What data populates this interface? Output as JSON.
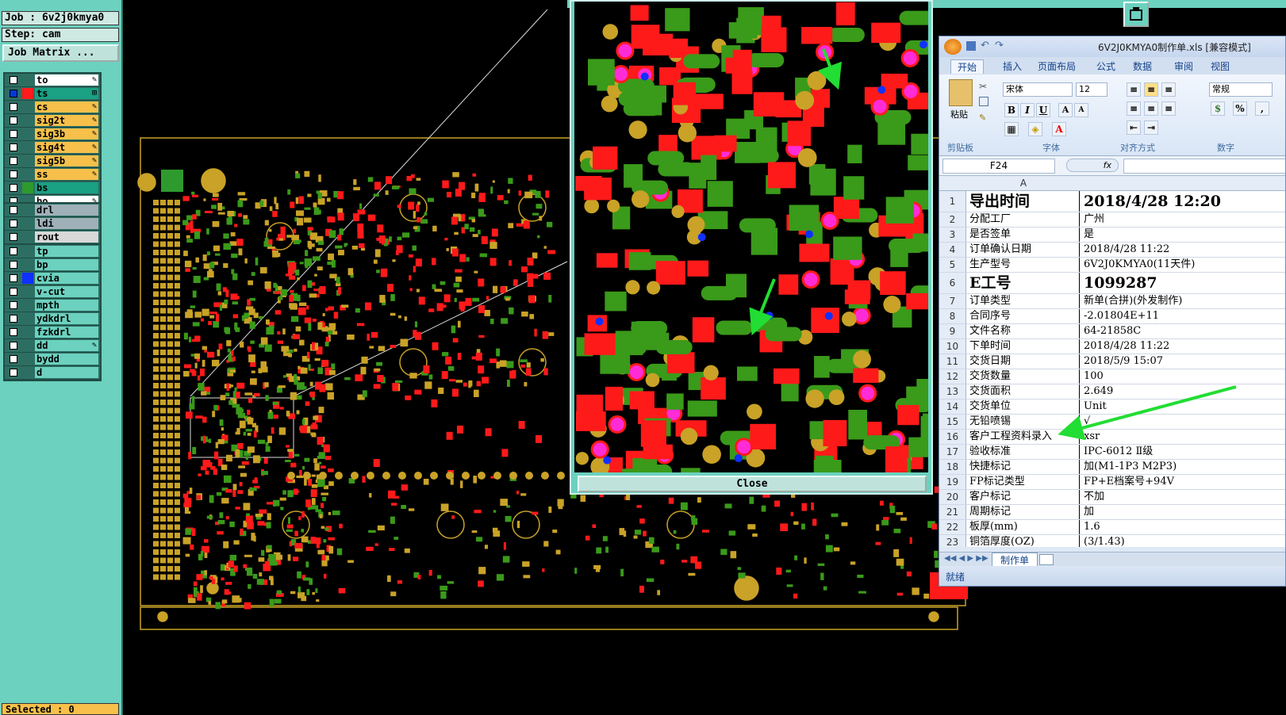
{
  "cam": {
    "job_label": "Job : 6v2j0kmya0",
    "step_label": "Step: cam",
    "job_matrix_label": "Job Matrix ...",
    "selected_label": "Selected : 0",
    "close_label": "Close",
    "layer_groups": [
      {
        "layers": [
          {
            "name": "to",
            "color": "#ffffff",
            "swatch": "",
            "checked": false,
            "mark": "✎"
          },
          {
            "name": "ts",
            "color": "#1aa082",
            "swatch": "#ff1a1a",
            "checked": true,
            "mark": "⊞"
          },
          {
            "name": "cs",
            "color": "#f7c04a",
            "swatch": "",
            "checked": false,
            "mark": "✎"
          },
          {
            "name": "sig2t",
            "color": "#f7c04a",
            "swatch": "",
            "checked": false,
            "mark": "✎"
          },
          {
            "name": "sig3b",
            "color": "#f7c04a",
            "swatch": "",
            "checked": false,
            "mark": "✎"
          },
          {
            "name": "sig4t",
            "color": "#f7c04a",
            "swatch": "",
            "checked": false,
            "mark": "✎"
          },
          {
            "name": "sig5b",
            "color": "#f7c04a",
            "swatch": "",
            "checked": false,
            "mark": "✎"
          },
          {
            "name": "ss",
            "color": "#f7c04a",
            "swatch": "",
            "checked": false,
            "mark": "✎"
          },
          {
            "name": "bs",
            "color": "#1aa082",
            "swatch": "#2e9a2e",
            "checked": false,
            "mark": ""
          },
          {
            "name": "bo",
            "color": "#ffffff",
            "swatch": "",
            "checked": false,
            "mark": "✎"
          }
        ]
      },
      {
        "layers": [
          {
            "name": "drl",
            "color": "#9fb0b8",
            "swatch": "",
            "checked": false,
            "mark": ""
          },
          {
            "name": "ldi",
            "color": "#9fb0b8",
            "swatch": "",
            "checked": false,
            "mark": ""
          },
          {
            "name": "rout",
            "color": "#d8d8d8",
            "swatch": "",
            "checked": false,
            "mark": ""
          }
        ]
      },
      {
        "layers": [
          {
            "name": "tp",
            "color": "#6cd1bf",
            "swatch": "",
            "checked": false,
            "mark": ""
          },
          {
            "name": "bp",
            "color": "#6cd1bf",
            "swatch": "",
            "checked": false,
            "mark": ""
          },
          {
            "name": "cvia",
            "color": "#6cd1bf",
            "swatch": "#1030ff",
            "checked": false,
            "mark": ""
          },
          {
            "name": "v-cut",
            "color": "#6cd1bf",
            "swatch": "",
            "checked": false,
            "mark": ""
          },
          {
            "name": "mpth",
            "color": "#6cd1bf",
            "swatch": "",
            "checked": false,
            "mark": ""
          },
          {
            "name": "ydkdrl",
            "color": "#6cd1bf",
            "swatch": "",
            "checked": false,
            "mark": ""
          },
          {
            "name": "fzkdrl",
            "color": "#6cd1bf",
            "swatch": "",
            "checked": false,
            "mark": ""
          },
          {
            "name": "dd",
            "color": "#6cd1bf",
            "swatch": "",
            "checked": false,
            "mark": "✎"
          },
          {
            "name": "bydd",
            "color": "#6cd1bf",
            "swatch": "",
            "checked": false,
            "mark": ""
          },
          {
            "name": "d",
            "color": "#6cd1bf",
            "swatch": "",
            "checked": false,
            "mark": ""
          }
        ]
      }
    ]
  },
  "excel": {
    "title": "6V2J0KMYA0制作单.xls [兼容模式]",
    "tabs": [
      "开始",
      "插入",
      "页面布局",
      "公式",
      "数据",
      "审阅",
      "视图"
    ],
    "ribbon": {
      "paste_label": "粘贴",
      "clipboard_label": "剪贴板",
      "font_name": "宋体",
      "font_size": "12",
      "font_group_label": "字体",
      "align_group_label": "对齐方式",
      "number_format": "常规",
      "number_group_label": "数字",
      "bold": "B",
      "italic": "I",
      "underline": "U"
    },
    "name_box": "F24",
    "fx_label": "fx",
    "column_header": "A",
    "sheet_tab": "制作单",
    "status": "就绪",
    "rows": [
      {
        "n": "1",
        "a": "导出时间",
        "b": "2018/4/28  12:20",
        "big": true
      },
      {
        "n": "2",
        "a": "分配工厂",
        "b": "广州"
      },
      {
        "n": "3",
        "a": "是否签单",
        "b": "是"
      },
      {
        "n": "4",
        "a": "订单确认日期",
        "b": "2018/4/28 11:22"
      },
      {
        "n": "5",
        "a": "生产型号",
        "b": "6V2J0KMYA0(11天件)"
      },
      {
        "n": "6",
        "a": "E工号",
        "b": "1099287",
        "big": true
      },
      {
        "n": "7",
        "a": "订单类型",
        "b": "新单(合拼)(外发制作)"
      },
      {
        "n": "8",
        "a": "合同序号",
        "b": "-2.01804E+11"
      },
      {
        "n": "9",
        "a": "文件名称",
        "b": "64-21858C"
      },
      {
        "n": "10",
        "a": "下单时间",
        "b": "2018/4/28 11:22"
      },
      {
        "n": "11",
        "a": "交货日期",
        "b": "2018/5/9 15:07"
      },
      {
        "n": "12",
        "a": "交货数量",
        "b": "100"
      },
      {
        "n": "13",
        "a": "交货面积",
        "b": "2.649"
      },
      {
        "n": "14",
        "a": "交货单位",
        "b": "Unit"
      },
      {
        "n": "15",
        "a": "无铅喷锡",
        "b": "√"
      },
      {
        "n": "16",
        "a": "客户工程资料录入",
        "b": "xsr"
      },
      {
        "n": "17",
        "a": "验收标准",
        "b": "IPC-6012 Ⅱ级"
      },
      {
        "n": "18",
        "a": "快捷标记",
        "b": "加(M1-1P3 M2P3)"
      },
      {
        "n": "19",
        "a": "FP标记类型",
        "b": "FP+E档案号+94V"
      },
      {
        "n": "20",
        "a": "客户标记",
        "b": "不加"
      },
      {
        "n": "21",
        "a": "周期标记",
        "b": "加"
      },
      {
        "n": "22",
        "a": "板厚(mm)",
        "b": "1.6"
      },
      {
        "n": "23",
        "a": "铜箔厚度(OZ)",
        "b": "(3/1.43)"
      }
    ]
  },
  "colors": {
    "panel": "#6cd1bf",
    "board_outline": "#c9a227",
    "pad_red": "#ff1a1a",
    "pad_green": "#3a9a1a",
    "pad_gold": "#c9a227",
    "arrow": "#22dd33"
  }
}
